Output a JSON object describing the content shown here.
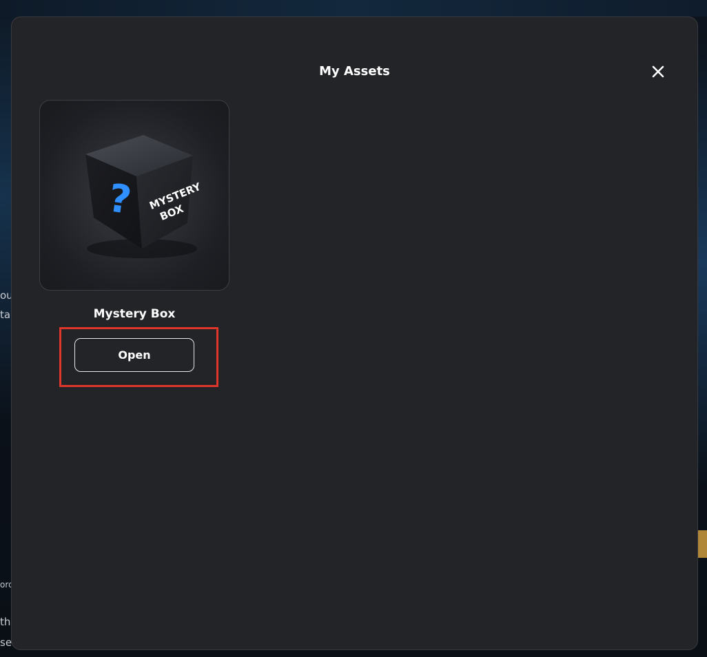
{
  "modal": {
    "title": "My Assets",
    "close_icon": "close-icon"
  },
  "assets": [
    {
      "name": "Mystery Box",
      "image_text_line1": "MYSTERY",
      "image_text_line2": "BOX",
      "image_glyph": "?",
      "action_label": "Open"
    }
  ],
  "background": {
    "left_fragments": [
      "ou",
      "ta",
      "th",
      "se",
      "ord"
    ]
  },
  "colors": {
    "modal_bg": "#232428",
    "highlight": "#e0352b",
    "accent_blue": "#2f8fff",
    "accent_gold": "#d9a441"
  }
}
